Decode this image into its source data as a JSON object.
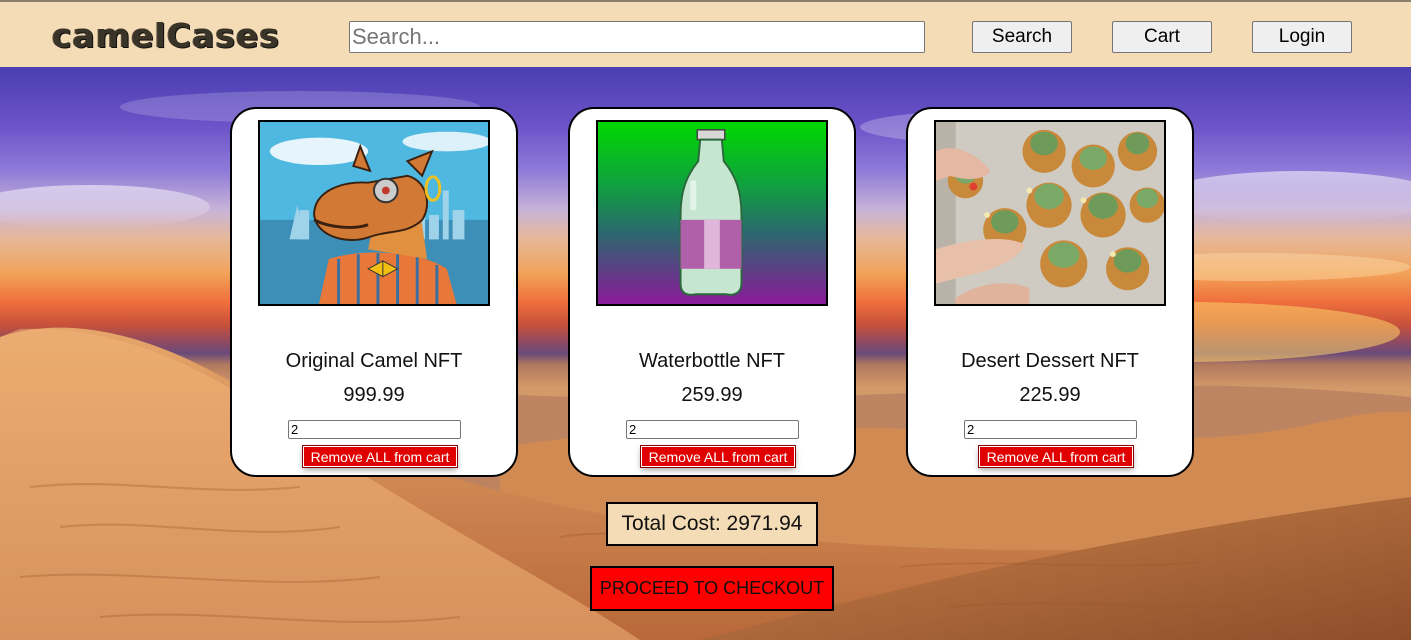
{
  "header": {
    "logo": "camelCases",
    "search_placeholder": "Search...",
    "search_button": "Search",
    "cart_button": "Cart",
    "login_button": "Login"
  },
  "cart": {
    "items": [
      {
        "name": "Original Camel NFT",
        "price": "999.99",
        "quantity": "2",
        "remove_label": "Remove ALL from cart",
        "image": "camel-nft-image"
      },
      {
        "name": "Waterbottle NFT",
        "price": "259.99",
        "quantity": "2",
        "remove_label": "Remove ALL from cart",
        "image": "waterbottle-nft-image"
      },
      {
        "name": "Desert Dessert NFT",
        "price": "225.99",
        "quantity": "2",
        "remove_label": "Remove ALL from cart",
        "image": "desert-dessert-nft-image"
      }
    ],
    "total_label": "Total Cost: 2971.94",
    "checkout_label": "PROCEED TO CHECKOUT"
  },
  "colors": {
    "header_bg": "#f4dcb6",
    "remove_button": "#e00000",
    "checkout_button": "#ff0000",
    "total_bg": "#f4dcb6"
  }
}
